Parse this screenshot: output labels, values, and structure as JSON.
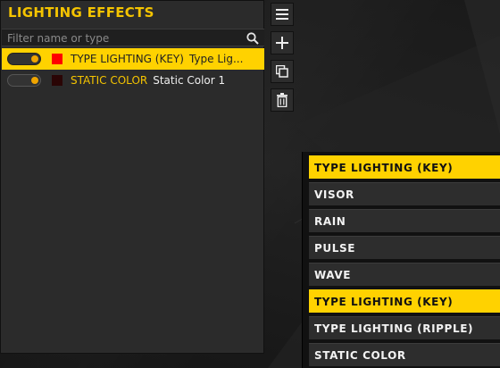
{
  "panel": {
    "title": "LIGHTING EFFECTS",
    "search_placeholder": "Filter name or type"
  },
  "effects": [
    {
      "type": "TYPE LIGHTING (KEY)",
      "name": "Type Lig...",
      "color": "#ff0000",
      "selected": true
    },
    {
      "type": "STATIC COLOR",
      "name": "Static Color 1",
      "color": "#2a0505",
      "selected": false
    }
  ],
  "toolbar": {
    "menu": "hamburger-icon",
    "add": "plus-icon",
    "duplicate": "copy-icon",
    "delete": "trash-icon"
  },
  "dropdown": {
    "items": [
      "TYPE LIGHTING (KEY)",
      "VISOR",
      "RAIN",
      "PULSE",
      "WAVE",
      "TYPE LIGHTING (KEY)",
      "TYPE LIGHTING (RIPPLE)",
      "STATIC COLOR"
    ],
    "highlighted": [
      0,
      5
    ]
  },
  "colors": {
    "accent": "#ffd200",
    "title": "#f5c400",
    "panel": "#2b2b2b"
  }
}
